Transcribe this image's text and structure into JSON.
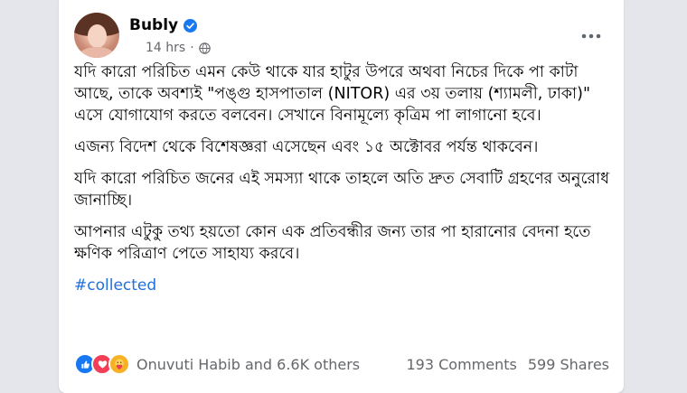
{
  "post": {
    "author": "Bubly",
    "time": "14 hrs",
    "separator": "·",
    "paragraphs": [
      "যদি কারো পরিচিত এমন কেউ থাকে যার হাটুর উপরে অথবা নিচের দিকে পা কাটা আছে, তাকে অবশ্যই \"পঙ্গু হাসপাতাল (NITOR) এর ৩য় তলায় (শ্যামলী, ঢাকা)\" এসে যোগাযোগ করতে বলবেন। সেখানে বিনামূল্যে কৃত্রিম পা লাগানো হবে।",
      "এজন্য বিদেশ থেকে বিশেষজ্ঞরা এসেছেন এবং ১৫ অক্টোবর পর্যন্ত থাকবেন।",
      "যদি কারো পরিচিত জনের এই সমস্যা থাকে তাহলে অতি দ্রুত সেবাটি গ্রহণের অনুরোধ জানাচ্ছি।",
      "আপনার এটুকু তথ্য হয়তো কোন এক প্রতিবন্ধীর জন্য তার পা হারানোর বেদনা হতে ক্ষণিক পরিত্রাণ পেতে সাহায্য করবে।"
    ],
    "hashtag": "#collected",
    "reactions_text": "Onuvuti Habib and 6.6K others",
    "comments": "193 Comments",
    "shares": "599 Shares",
    "icons": [
      "verified-badge-icon",
      "globe-icon",
      "more-options-icon",
      "like-reaction-icon",
      "love-reaction-icon",
      "care-reaction-icon"
    ]
  },
  "colors": {
    "background": "#e4e6eb",
    "card": "#ffffff",
    "link": "#216fdb",
    "secondary_text": "#65676b",
    "verified": "#1877f2",
    "like": "#1877f2",
    "love": "#f33e58",
    "care": "#f7b125"
  }
}
